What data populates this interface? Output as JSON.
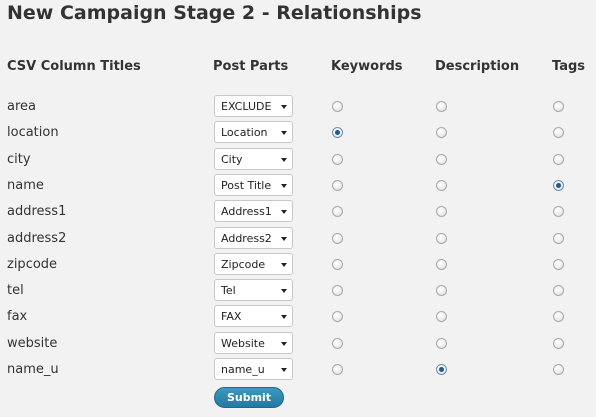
{
  "page": {
    "title": "New Campaign Stage 2 - Relationships"
  },
  "headers": {
    "csv_column_titles": "CSV Column Titles",
    "post_parts": "Post Parts",
    "keywords": "Keywords",
    "description": "Description",
    "tags": "Tags"
  },
  "rows": [
    {
      "column": "area",
      "post_part": "EXCLUDE",
      "keywords": false,
      "description": false,
      "tags": false
    },
    {
      "column": "location",
      "post_part": "Location",
      "keywords": true,
      "description": false,
      "tags": false
    },
    {
      "column": "city",
      "post_part": "City",
      "keywords": false,
      "description": false,
      "tags": false
    },
    {
      "column": "name",
      "post_part": "Post Title",
      "keywords": false,
      "description": false,
      "tags": true
    },
    {
      "column": "address1",
      "post_part": "Address1",
      "keywords": false,
      "description": false,
      "tags": false
    },
    {
      "column": "address2",
      "post_part": "Address2",
      "keywords": false,
      "description": false,
      "tags": false
    },
    {
      "column": "zipcode",
      "post_part": "Zipcode",
      "keywords": false,
      "description": false,
      "tags": false
    },
    {
      "column": "tel",
      "post_part": "Tel",
      "keywords": false,
      "description": false,
      "tags": false
    },
    {
      "column": "fax",
      "post_part": "FAX",
      "keywords": false,
      "description": false,
      "tags": false
    },
    {
      "column": "website",
      "post_part": "Website",
      "keywords": false,
      "description": false,
      "tags": false
    },
    {
      "column": "name_u",
      "post_part": "name_u",
      "keywords": false,
      "description": true,
      "tags": false
    }
  ],
  "submit_label": "Submit",
  "colors": {
    "button": "#2a86b0",
    "radio_checked": "#1d5a8e",
    "background": "#f2f2f2"
  }
}
